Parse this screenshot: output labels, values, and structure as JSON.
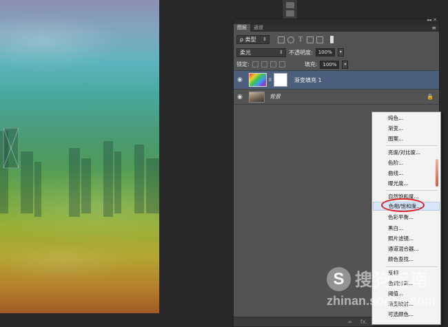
{
  "panel": {
    "tabs": [
      "图层",
      "通道"
    ],
    "filter_label": "ρ 类型",
    "blend_mode": "柔光",
    "opacity_label": "不透明度:",
    "opacity_value": "100%",
    "lock_label": "锁定:",
    "fill_label": "填充:",
    "fill_value": "100%",
    "layers": [
      {
        "name": "渐变填充 1",
        "selected": true
      },
      {
        "name": "背景",
        "selected": false,
        "locked": true
      }
    ],
    "footer_fx": "fx."
  },
  "menu": {
    "items": [
      "纯色...",
      "渐变...",
      "图案...",
      "亮度/对比度...",
      "色阶...",
      "曲线...",
      "曝光度...",
      "自然饱和度...",
      "色相/饱和度...",
      "色彩平衡...",
      "黑白...",
      "照片滤镜...",
      "通道混合器...",
      "颜色查找...",
      "反相",
      "色调分离...",
      "阈值...",
      "渐变映射...",
      "可选颜色..."
    ],
    "highlighted": "色相/饱和度..."
  },
  "watermark": {
    "logo": "S",
    "text": "搜狗指南",
    "url": "zhinan.sogou.com"
  }
}
